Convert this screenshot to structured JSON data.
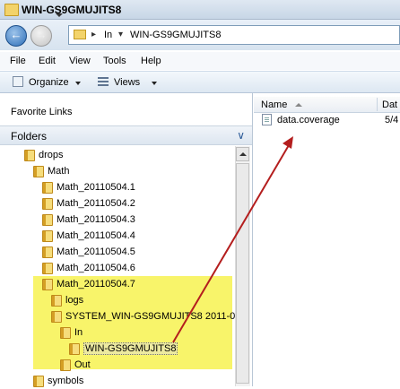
{
  "window": {
    "title": "WIN-GS9GMUJITS8"
  },
  "address": {
    "crumbs": [
      "In",
      "WIN-GS9GMUJITS8"
    ]
  },
  "menu": {
    "items": [
      "File",
      "Edit",
      "View",
      "Tools",
      "Help"
    ]
  },
  "toolbar": {
    "organize": "Organize",
    "views": "Views"
  },
  "leftpane": {
    "favorite_links": "Favorite Links",
    "folders": "Folders",
    "tree": [
      {
        "label": "drops"
      },
      {
        "label": "Math"
      },
      {
        "label": "Math_20110504.1"
      },
      {
        "label": "Math_20110504.2"
      },
      {
        "label": "Math_20110504.3"
      },
      {
        "label": "Math_20110504.4"
      },
      {
        "label": "Math_20110504.5"
      },
      {
        "label": "Math_20110504.6"
      },
      {
        "label": "Math_20110504.7"
      },
      {
        "label": "logs"
      },
      {
        "label": "SYSTEM_WIN-GS9GMUJITS8 2011-05-0"
      },
      {
        "label": "In"
      },
      {
        "label": "WIN-GS9GMUJITS8"
      },
      {
        "label": "Out"
      },
      {
        "label": "symbols"
      }
    ]
  },
  "filelist": {
    "columns": {
      "name": "Name",
      "date": "Dat"
    },
    "rows": [
      {
        "name": "data.coverage",
        "date": "5/4"
      }
    ]
  },
  "colors": {
    "highlight": "#f8f46a",
    "annotation_arrow": "#b41e1e"
  }
}
